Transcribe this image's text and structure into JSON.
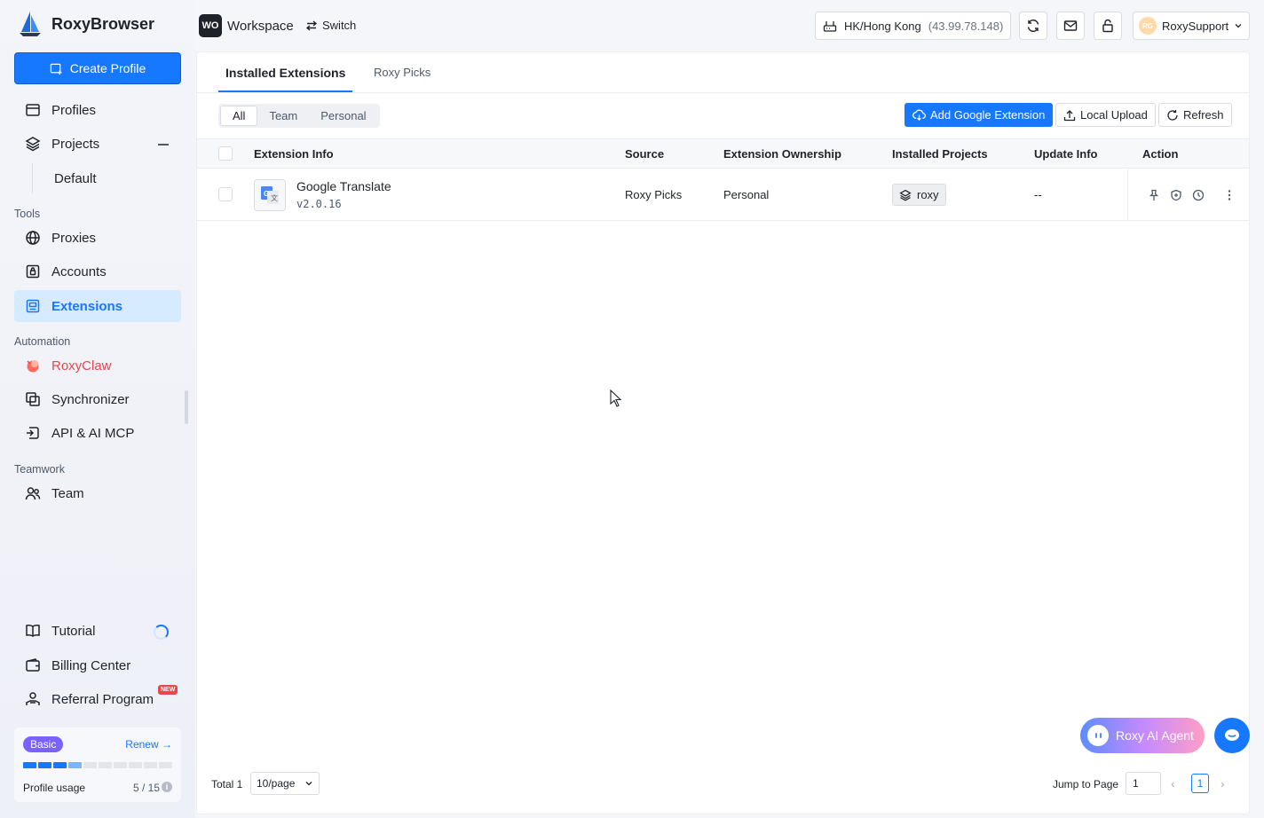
{
  "app": {
    "name": "RoxyBrowser"
  },
  "sidebar": {
    "create_label": "Create Profile",
    "profiles": "Profiles",
    "projects": "Projects",
    "projects_sub": "Default",
    "tools_label": "Tools",
    "proxies": "Proxies",
    "accounts": "Accounts",
    "extensions": "Extensions",
    "automation_label": "Automation",
    "roxyclaw": "RoxyClaw",
    "synchronizer": "Synchronizer",
    "api": "API & AI MCP",
    "teamwork_label": "Teamwork",
    "team": "Team",
    "tutorial": "Tutorial",
    "billing": "Billing Center",
    "referral": "Referral Program",
    "new_badge": "NEW",
    "plan": {
      "badge": "Basic",
      "renew": "Renew",
      "usage_label": "Profile usage",
      "usage_value": "5 / 15",
      "usage_used": 5,
      "usage_total": 15
    }
  },
  "topbar": {
    "workspace_badge": "WO",
    "workspace_name": "Workspace",
    "switch_label": "Switch",
    "proxy_location": "HK/Hong Kong",
    "proxy_ip": "(43.99.78.148)",
    "user_initials": "RG",
    "user_name": "RoxySupport"
  },
  "tabs": {
    "installed": "Installed Extensions",
    "picks": "Roxy Picks"
  },
  "filters": {
    "all": "All",
    "team": "Team",
    "personal": "Personal"
  },
  "actions": {
    "add_google": "Add Google Extension",
    "local_upload": "Local Upload",
    "refresh": "Refresh"
  },
  "table": {
    "headers": {
      "info": "Extension Info",
      "source": "Source",
      "ownership": "Extension Ownership",
      "projects": "Installed Projects",
      "update": "Update Info",
      "action": "Action"
    },
    "rows": [
      {
        "name": "Google Translate",
        "version": "v2.0.16",
        "source": "Roxy Picks",
        "ownership": "Personal",
        "project": "roxy",
        "update": "--"
      }
    ]
  },
  "pagination": {
    "total": "Total 1",
    "page_size": "10/page",
    "jump_label": "Jump to Page",
    "jump_value": "1",
    "current": "1"
  },
  "floating": {
    "ai_agent": "Roxy AI Agent"
  },
  "colors": {
    "accent": "#1677ff",
    "claw": "#e5484d",
    "plan_badge": "#7b61ff"
  }
}
